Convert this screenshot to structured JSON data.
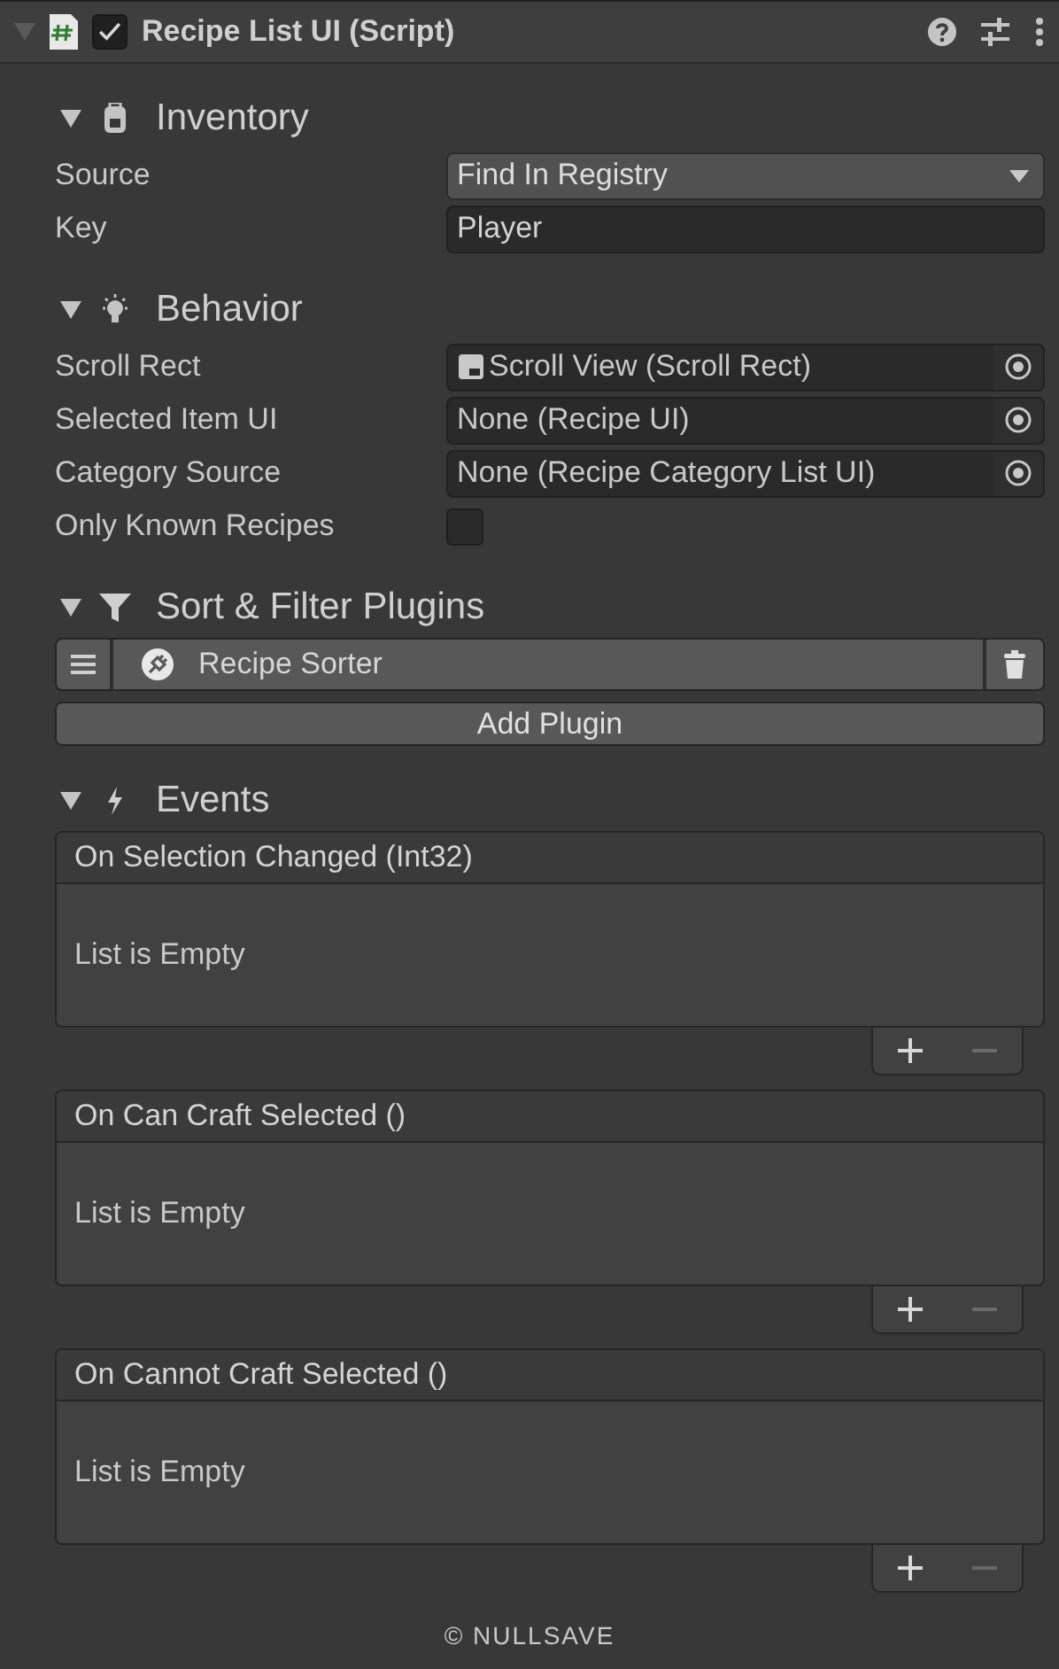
{
  "header": {
    "title": "Recipe List UI (Script)",
    "enabled": true
  },
  "sections": [
    {
      "kind": "fields",
      "title": "Inventory",
      "expanded": true,
      "fields": [
        {
          "kind": "dropdown",
          "label": "Source",
          "value": "Find In Registry"
        },
        {
          "kind": "text",
          "label": "Key",
          "value": "Player"
        }
      ]
    },
    {
      "kind": "fields",
      "title": "Behavior",
      "expanded": true,
      "fields": [
        {
          "kind": "object",
          "label": "Scroll Rect",
          "value": "Scroll View (Scroll Rect)",
          "has_icon": true
        },
        {
          "kind": "object",
          "label": "Selected Item UI",
          "value": "None (Recipe UI)",
          "has_icon": false
        },
        {
          "kind": "object",
          "label": "Category Source",
          "value": "None (Recipe Category List UI)",
          "has_icon": false
        },
        {
          "kind": "checkbox",
          "label": "Only Known Recipes",
          "checked": false
        }
      ]
    },
    {
      "kind": "plugins",
      "title": "Sort & Filter Plugins",
      "expanded": true,
      "plugins": [
        "Recipe Sorter"
      ],
      "add_label": "Add Plugin"
    },
    {
      "kind": "events",
      "title": "Events",
      "expanded": true,
      "events": [
        {
          "title": "On Selection Changed (Int32)",
          "empty_text": "List is Empty",
          "remove_disabled": true
        },
        {
          "title": "On Can Craft Selected ()",
          "empty_text": "List is Empty",
          "remove_disabled": true
        },
        {
          "title": "On Cannot Craft Selected ()",
          "empty_text": "List is Empty",
          "remove_disabled": true
        }
      ]
    }
  ],
  "footer": "© NULLSAVE"
}
